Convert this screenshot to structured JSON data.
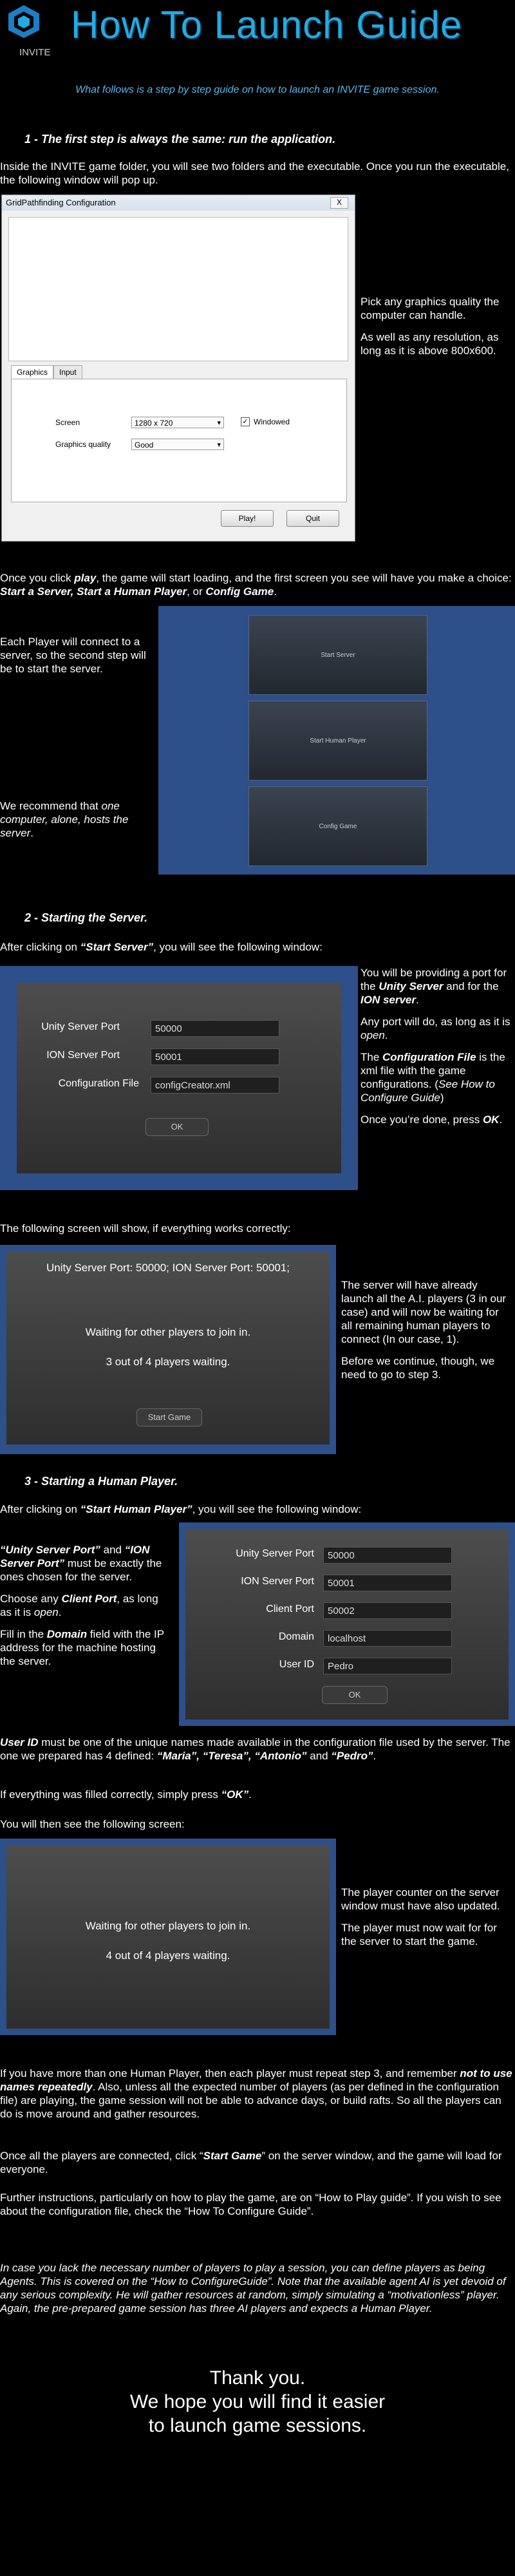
{
  "header": {
    "logo_text": "INVITE",
    "title": "How To Launch Guide",
    "intro": "What follows is a step by step guide on how to launch an INVITE game session."
  },
  "step1": {
    "heading": "1 - The first step is always the same: run the application.",
    "text": "Inside the INVITE game folder, you will see two folders and the executable. Once you run the executable, the following window will pop up."
  },
  "config_window": {
    "title": "GridPathfinding Configuration",
    "close": "X",
    "tabs": [
      "Graphics",
      "Input"
    ],
    "screen_label": "Screen",
    "screen_value": "1280 x 720",
    "windowed_label": "Windowed",
    "quality_label": "Graphics quality",
    "quality_value": "Good",
    "play": "Play!",
    "quit": "Quit"
  },
  "side1": {
    "p1": "Pick any graphics quality the computer can handle.",
    "p2": "As well as any resolution, as long as it is above 800x600."
  },
  "after_play": {
    "t1": "Once you click ",
    "play": "play",
    "t2": ", the game will start loading, and the first screen you see will have you make a choice: ",
    "choices": "Start a Server, Start a Human Player",
    "t3": ", or ",
    "config": "Config Game",
    "t4": "."
  },
  "menu_side": {
    "p1": "Each Player will connect to a server, so the second step will be to start the server.",
    "p2a": "We recommend that ",
    "p2b": "one computer, alone, hosts the server",
    "p2c": "."
  },
  "menu_buttons": [
    "Start Server",
    "Start Human Player",
    "Config Game"
  ],
  "step2": {
    "heading": "2 - Starting the Server.",
    "t1": "After clicking on ",
    "btn": "“Start Server”",
    "t2": ", you will see the following window:"
  },
  "server_window": {
    "unity_label": "Unity Server Port",
    "unity_value": "50000",
    "ion_label": "ION Server Port",
    "ion_value": "50001",
    "config_label": "Configuration File",
    "config_value": "configCreator.xml",
    "ok": "OK"
  },
  "server_side": {
    "p1a": "You will be providing a port for the ",
    "p1b": "Unity Server",
    "p1c": " and for the ",
    "p1d": "ION server",
    "p1e": ".",
    "p2a": "Any port will do, as long as it is ",
    "p2b": "open",
    "p2c": ".",
    "p3a": "The ",
    "p3b": "Configuration File",
    "p3c": " is the xml file with the game configurations. (",
    "p3d": "See How to Configure Guide",
    "p3e": ")",
    "p4a": "Once you’re done, press ",
    "p4b": "OK",
    "p4c": "."
  },
  "following_screen": "The following screen will show, if everything works correctly:",
  "wait_window": {
    "ports": "Unity Server Port: 50000; ION Server Port: 50001;",
    "waiting": "Waiting for other players to join in.",
    "count": "3 out of 4 players waiting.",
    "start": "Start Game"
  },
  "wait_side": {
    "p1": "The server will have already launch all the A.I. players (3 in our case) and will now be waiting for all remaining human players to connect (In our case, 1).",
    "p2": "Before we continue, though, we need to go to step 3."
  },
  "step3": {
    "heading": "3 - Starting a Human Player.",
    "t1": "After clicking on ",
    "btn": "“Start Human Player”",
    "t2": ", you will see the following window:"
  },
  "human_side": {
    "p1a": "“Unity Server Port”",
    "p1b": " and ",
    "p1c": "“ION Server Port”",
    "p1d": " must be exactly the ones chosen for the server.",
    "p2a": "Choose any ",
    "p2b": "Client Port",
    "p2c": ", as long as it is ",
    "p2d": "open",
    "p2e": ".",
    "p3a": "Fill in the ",
    "p3b": "Domain",
    "p3c": " field with the IP address for the machine hosting the server."
  },
  "human_window": {
    "unity_label": "Unity Server Port",
    "unity_value": "50000",
    "ion_label": "ION Server Port",
    "ion_value": "50001",
    "client_label": "Client Port",
    "client_value": "50002",
    "domain_label": "Domain",
    "domain_value": "localhost",
    "user_label": "User ID",
    "user_value": "Pedro",
    "ok": "OK"
  },
  "userid_para": {
    "a": "User ID",
    "b": " must be one of the unique names made available in the configuration file used by the server. The one we prepared has 4 defined: ",
    "c": "“Maria”, “Teresa”, “Antonio”",
    "d": " and ",
    "e": "“Pedro”",
    "f": "."
  },
  "ok_para": {
    "a": "If everything was filled correctly, simply press ",
    "b": "“OK”",
    "c": "."
  },
  "then_screen": "You will then see the following  screen:",
  "human_wait": {
    "waiting": "Waiting for other players to join in.",
    "count": "4 out of 4 players waiting."
  },
  "human_wait_side": {
    "p1": "The player counter on the server window must have also updated.",
    "p2": "The player must now wait for for the server to start the game."
  },
  "multi_para": {
    "a": "If you have more than one Human Player, then each player must repeat step 3, and remember ",
    "b": "not to use names repeatedly",
    "c": ". Also, unless all the expected number of players (as per defined in the configuration file) are playing, the game session will not be able to advance days, or build rafts. So all the players can do is move around and gather resources."
  },
  "connected_para": {
    "a": "Once all the players are connected, click “",
    "b": "Start Game",
    "c": "” on the server window, and the game will load for everyone."
  },
  "further_para": "Further instructions, particularly on how to play the game, are on “How to Play guide”. If you wish to see about the configuration file, check the “How To Configure Guide”.",
  "agents_para": "In case you lack the necessary number of players to play a session, you can define players as being Agents. This is covered on the “How to ConfigureGuide”. Note that the available agent AI is yet devoid of any serious complexity. He will gather resources at random, simply simulating a “motivationless” player. Again, the pre-prepared game session has three AI players and expects a Human Player.",
  "thanks": {
    "l1": "Thank you.",
    "l2": "We hope you will find it easier",
    "l3": "to launch game sessions."
  },
  "colors": {
    "title": "#26a9e0",
    "intro": "#5fb4ea",
    "frame": "#2d4f8a"
  }
}
